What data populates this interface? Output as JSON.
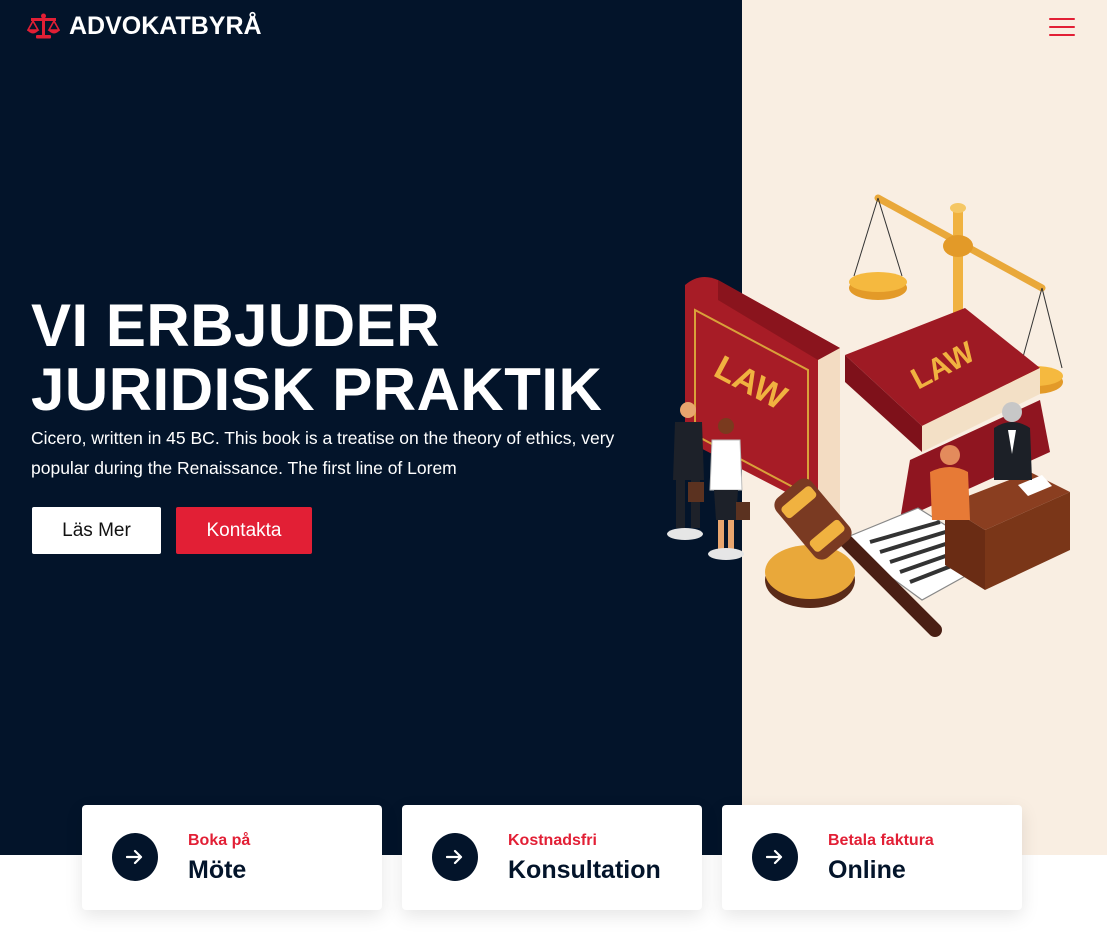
{
  "brand": {
    "name": "ADVOKATBYRÅ",
    "icon": "scales-icon"
  },
  "colors": {
    "dark": "#03142a",
    "accent": "#e21f35",
    "cream": "#f9eee2",
    "white": "#ffffff"
  },
  "hero": {
    "headline_line1": "VI ERBJUDER",
    "headline_line2": "JURIDISK PRAKTIK",
    "subtitle": "Cicero, written in 45 BC. This book is a treatise on the theory of ethics, very popular during the Renaissance. The first line of Lorem",
    "read_more_label": "Läs Mer",
    "contact_label": "Kontakta"
  },
  "illustration": {
    "book_label_1": "LAW",
    "book_label_2": "LAW"
  },
  "cards": [
    {
      "small": "Boka på",
      "big": "Möte",
      "icon": "arrow-right-icon"
    },
    {
      "small": "Kostnadsfri",
      "big": "Konsultation",
      "icon": "arrow-right-icon"
    },
    {
      "small": "Betala faktura",
      "big": "Online",
      "icon": "arrow-right-icon"
    }
  ]
}
